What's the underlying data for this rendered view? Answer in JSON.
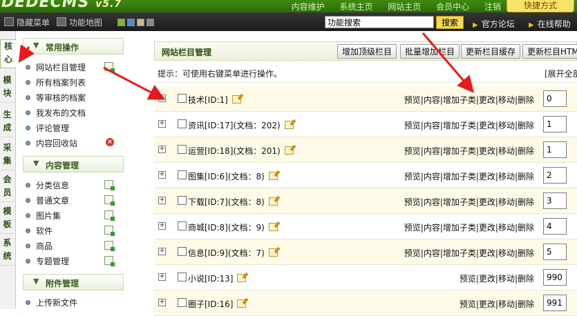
{
  "header": {
    "logo_text": "DEDECMS",
    "logo_version": "v5.7",
    "top_links": [
      "内容维护",
      "系统主页",
      "网站主页",
      "会员中心",
      "注销"
    ],
    "quick_button": "快捷方式"
  },
  "navbar": {
    "hide_menu": "隐藏菜单",
    "site_map": "功能地图",
    "skin_colors": [
      "#7dbb2a",
      "#4a90d9",
      "#c9b98a",
      "#8a8a8a"
    ],
    "search_value": "功能搜索",
    "search_button": "搜索",
    "forum_link": "官方论坛",
    "help_link": "在线帮助"
  },
  "tabs": [
    "核心",
    "模块",
    "生成",
    "采集",
    "会员",
    "模板",
    "系统"
  ],
  "sidebar": {
    "groups": [
      {
        "title": "常用操作",
        "items": [
          {
            "label": "网站栏目管理",
            "icon": "add-page-icon"
          },
          {
            "label": "所有档案列表"
          },
          {
            "label": "等审核的档案"
          },
          {
            "label": "我发布的文档"
          },
          {
            "label": "评论管理"
          },
          {
            "label": "内容回收站",
            "icon": "delete-icon"
          }
        ]
      },
      {
        "title": "内容管理",
        "items": [
          {
            "label": "分类信息",
            "icon": "add-page-icon"
          },
          {
            "label": "普通文章",
            "icon": "add-page-icon"
          },
          {
            "label": "图片集",
            "icon": "add-page-icon"
          },
          {
            "label": "软件",
            "icon": "add-page-icon"
          },
          {
            "label": "商品",
            "icon": "add-page-icon"
          },
          {
            "label": "专题管理",
            "icon": "add-page-icon"
          }
        ]
      },
      {
        "title": "附件管理",
        "items": [
          {
            "label": "上传新文件"
          }
        ]
      }
    ]
  },
  "main": {
    "title": "网站栏目管理",
    "buttons": [
      "增加顶级栏目",
      "批量增加栏目",
      "更新栏目缓存",
      "更新栏目HTML"
    ],
    "hint": "提示：可使用右键菜单进行操作。",
    "expand_all": "[展开全部]",
    "rows": [
      {
        "name": "技术[ID:1]",
        "ops": "预览|内容|增加子类|更改|移动|删除",
        "order": "0"
      },
      {
        "name": "资讯[ID:17](文档：202)",
        "ops": "预览|内容|增加子类|更改|移动|删除",
        "order": "1"
      },
      {
        "name": "运营[ID:18](文档：201)",
        "ops": "预览|内容|增加子类|更改|移动|删除",
        "order": "1"
      },
      {
        "name": "图集[ID:6](文档：8)",
        "ops": "预览|内容|增加子类|更改|移动|删除",
        "order": "2"
      },
      {
        "name": "下载[ID:7](文档：8)",
        "ops": "预览|内容|增加子类|更改|移动|删除",
        "order": "3"
      },
      {
        "name": "商城[ID:8](文档：9)",
        "ops": "预览|内容|增加子类|更改|移动|删除",
        "order": "4"
      },
      {
        "name": "信息[ID:9](文档：7)",
        "ops": "预览|内容|增加子类|更改|移动|删除",
        "order": "5"
      },
      {
        "name": "小说[ID:13]",
        "ops": "预览|更改|移动|删除",
        "order": "990"
      },
      {
        "name": "圈子[ID:16]",
        "ops": "预览|更改|移动|删除",
        "order": "991"
      }
    ]
  },
  "annotation_color": "#e8191a"
}
